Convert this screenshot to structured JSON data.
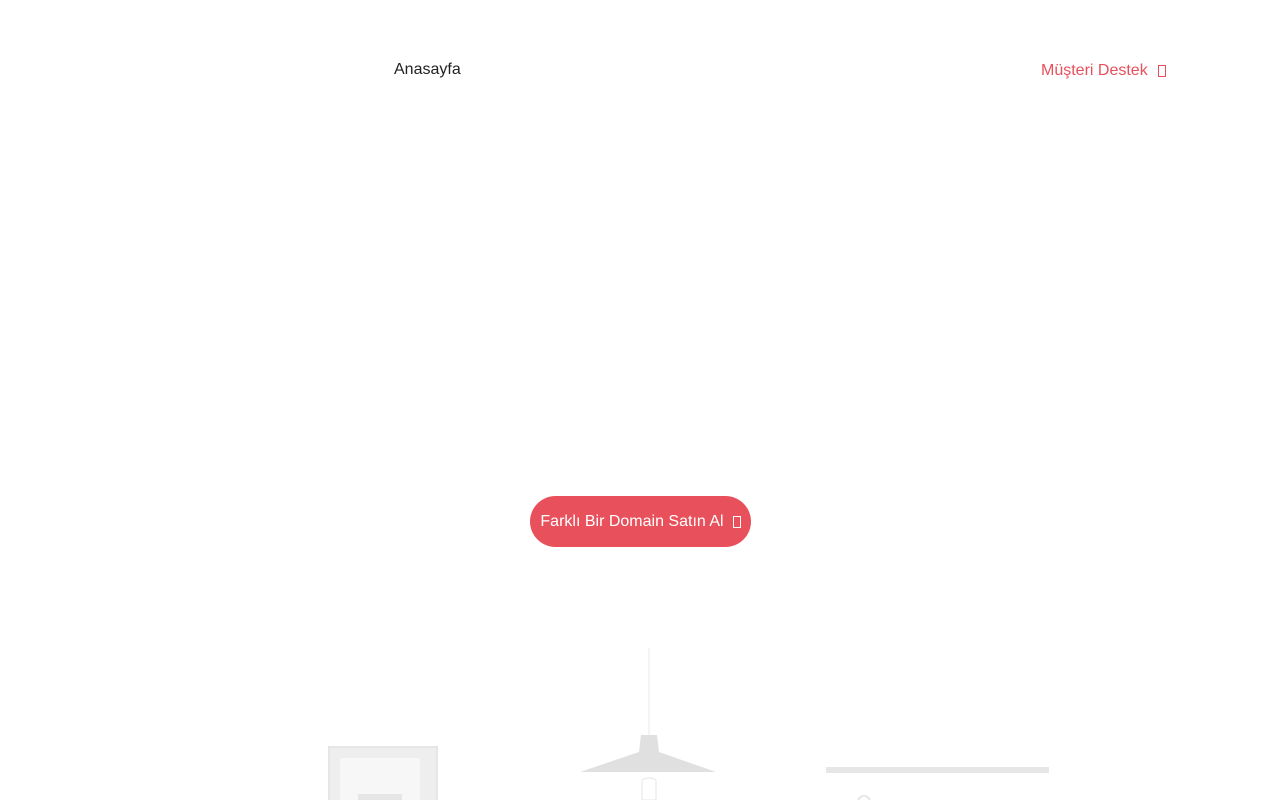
{
  "nav": {
    "home_label": "Anasayfa",
    "support_label": "Müşteri Destek",
    "support_icon": "external-box-icon"
  },
  "cta": {
    "label": "Farklı Bir Domain Satın Al",
    "icon": "external-box-icon"
  },
  "colors": {
    "accent": "#e8505c",
    "text": "#222222",
    "illustration": "#e3e3e3"
  }
}
